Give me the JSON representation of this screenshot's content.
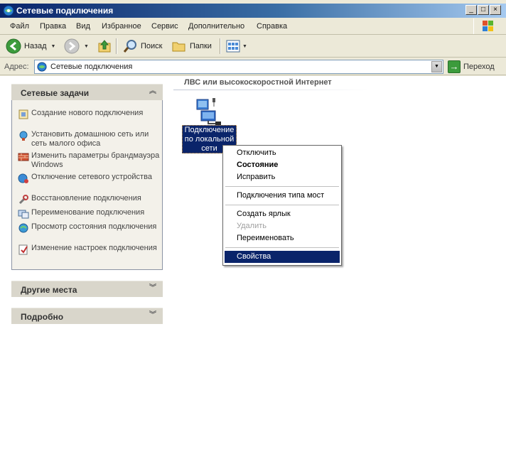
{
  "window": {
    "title": "Сетевые подключения",
    "caption_min": "_",
    "caption_max": "□",
    "caption_close": "×"
  },
  "menu": [
    "Файл",
    "Правка",
    "Вид",
    "Избранное",
    "Сервис",
    "Дополнительно",
    "Справка"
  ],
  "toolbar": {
    "back_label": "Назад",
    "search_label": "Поиск",
    "folders_label": "Папки"
  },
  "address": {
    "label": "Адрес:",
    "value": "Сетевые подключения",
    "go_label": "Переход"
  },
  "tasks_panel": {
    "title": "Сетевые задачи",
    "items": [
      {
        "label": "Создание нового подключения",
        "icon": "new-connection-icon"
      },
      {
        "label": "Установить домашнюю сеть или сеть малого офиса",
        "icon": "home-network-icon"
      },
      {
        "label": "Изменить параметры брандмауэра Windows",
        "icon": "firewall-icon"
      },
      {
        "label": "Отключение сетевого устройства",
        "icon": "disable-device-icon"
      },
      {
        "label": "Восстановление подключения",
        "icon": "repair-icon"
      },
      {
        "label": "Переименование подключения",
        "icon": "rename-icon"
      },
      {
        "label": "Просмотр состояния подключения",
        "icon": "status-icon"
      },
      {
        "label": "Изменение настроек подключения",
        "icon": "settings-icon"
      }
    ]
  },
  "other_places": {
    "title": "Другие места"
  },
  "details": {
    "title": "Подробно"
  },
  "group": {
    "title": "ЛВС или высокоскоростной Интернет"
  },
  "connection": {
    "name": "Подключение по локальной сети"
  },
  "context_menu": {
    "items": [
      {
        "label": "Отключить"
      },
      {
        "label": "Состояние"
      },
      {
        "label": "Исправить"
      },
      {
        "label": "Подключения типа мост"
      },
      {
        "label": "Создать ярлык"
      },
      {
        "label": "Удалить"
      },
      {
        "label": "Переименовать"
      },
      {
        "label": "Свойства"
      }
    ]
  }
}
